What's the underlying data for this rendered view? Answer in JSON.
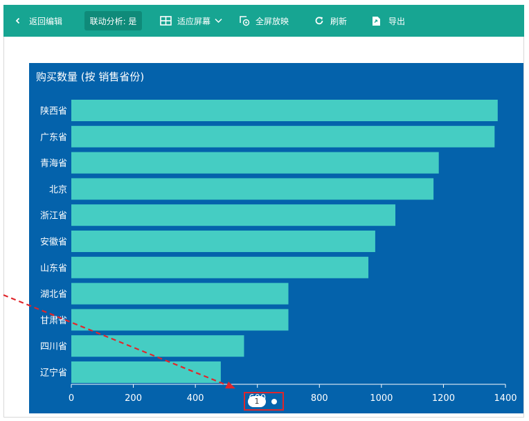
{
  "toolbar": {
    "back": "返回编辑",
    "linkage": "联动分析: 是",
    "fit_screen": "适应屏幕",
    "fullscreen": "全屏放映",
    "refresh": "刷新",
    "export": "导出"
  },
  "colors": {
    "toolbar_bg": "#17a592",
    "card_bg": "#0462ab",
    "bar": "#45cdc3",
    "annotation": "#e0262b"
  },
  "chart_data": {
    "type": "bar",
    "orientation": "horizontal",
    "title": "购买数量 (按 销售省份)",
    "categories": [
      "陕西省",
      "广东省",
      "青海省",
      "北京",
      "浙江省",
      "安徽省",
      "山东省",
      "湖北省",
      "甘肃省",
      "四川省",
      "辽宁省"
    ],
    "values": [
      1375,
      1365,
      1185,
      1168,
      1045,
      980,
      958,
      700,
      700,
      557,
      482
    ],
    "xlim": [
      0,
      1400
    ],
    "xticks": [
      "0",
      "200",
      "400",
      "600",
      "800",
      "1000",
      "1200",
      "1400"
    ],
    "grid": false,
    "legend": "none"
  },
  "pagination": {
    "current": "1"
  }
}
